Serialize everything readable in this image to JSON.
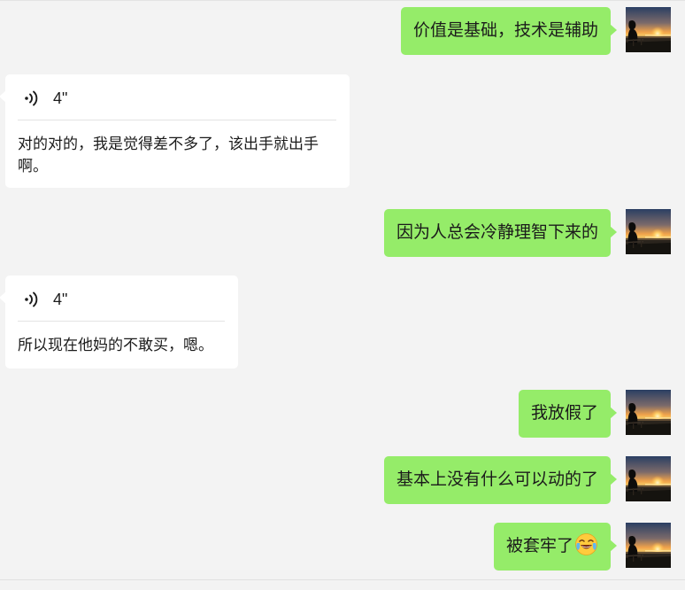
{
  "chat": {
    "messages": [
      {
        "type": "text",
        "direction": "out",
        "text": "价值是基础，技术是辅助"
      },
      {
        "type": "voice",
        "direction": "in",
        "duration": "4\"",
        "transcript": "对的对的，我是觉得差不多了，该出手就出手啊。"
      },
      {
        "type": "text",
        "direction": "out",
        "text": "因为人总会冷静理智下来的"
      },
      {
        "type": "voice",
        "direction": "in",
        "duration": "4\"",
        "transcript": "所以现在他妈的不敢买，嗯。"
      },
      {
        "type": "text",
        "direction": "out",
        "text": "我放假了"
      },
      {
        "type": "text",
        "direction": "out",
        "text": "基本上没有什么可以动的了"
      },
      {
        "type": "text",
        "direction": "out",
        "text": "被套牢了",
        "emoji": "loudly-crying-laughing-emoji"
      }
    ]
  },
  "colors": {
    "background": "#f3f3f3",
    "sent_bubble": "#95ec69",
    "received_bubble": "#ffffff",
    "text": "#1b1b1b"
  },
  "icons": {
    "voice": "voice-wave-icon",
    "avatar": "sunset-avatar"
  }
}
